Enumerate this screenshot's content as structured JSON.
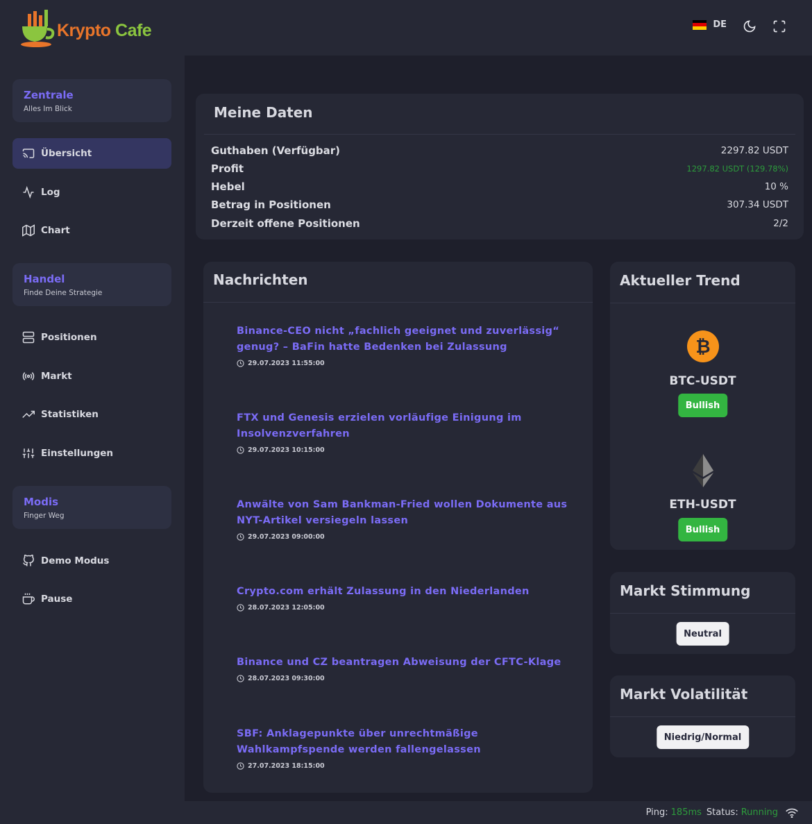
{
  "app": {
    "logo_main": "Krypto",
    "logo_accent": "Cafe"
  },
  "sidebar": {
    "sections": [
      {
        "title": "Zentrale",
        "subtitle": "Alles Im Blick"
      },
      {
        "title": "Handel",
        "subtitle": "Finde Deine Strategie"
      },
      {
        "title": "Modis",
        "subtitle": "Finger Weg"
      }
    ],
    "items": [
      {
        "label": "Übersicht",
        "icon": "screen-cast-icon",
        "active": true
      },
      {
        "label": "Log",
        "icon": "activity-icon"
      },
      {
        "label": "Chart",
        "icon": "map-icon"
      },
      {
        "label": "Positionen",
        "icon": "server-icon"
      },
      {
        "label": "Markt",
        "icon": "broadcast-icon"
      },
      {
        "label": "Statistiken",
        "icon": "trending-up-icon"
      },
      {
        "label": "Einstellungen",
        "icon": "sliders-icon"
      },
      {
        "label": "Demo Modus",
        "icon": "github-icon"
      },
      {
        "label": "Pause",
        "icon": "coffee-icon"
      }
    ]
  },
  "header": {
    "language": "DE",
    "flag_colors": [
      "#000000",
      "#dd0000",
      "#ffce00"
    ]
  },
  "meine_daten": {
    "title": "Meine Daten",
    "rows": [
      {
        "label": "Guthaben (Verfügbar)",
        "value": "2297.82 USDT"
      },
      {
        "label": "Profit",
        "value": "1297.82 USDT (129.78%)"
      },
      {
        "label": "Hebel",
        "value": "10 %"
      },
      {
        "label": "Betrag in Positionen",
        "value": "307.34 USDT"
      },
      {
        "label": "Derzeit offene Positionen",
        "value": "2/2"
      }
    ]
  },
  "news": {
    "title": "Nachrichten",
    "items": [
      {
        "title": "Binance-CEO nicht „fachlich geeignet und zuverlässig“ genug? – BaFin hatte Bedenken bei Zulassung",
        "date": "29.07.2023 11:55:00"
      },
      {
        "title": "FTX und Genesis erzielen vorläufige Einigung im Insolvenzverfahren",
        "date": "29.07.2023 10:15:00"
      },
      {
        "title": "Anwälte von Sam Bankman-Fried wollen Dokumente aus NYT-Artikel versiegeln lassen",
        "date": "29.07.2023 09:00:00"
      },
      {
        "title": "Crypto.com erhält Zulassung in den Niederlanden",
        "date": "28.07.2023 12:05:00"
      },
      {
        "title": "Binance und CZ beantragen Abweisung der CFTC-Klage",
        "date": "28.07.2023 09:30:00"
      },
      {
        "title": "SBF: Anklagepunkte über unrechtmäßige Wahlkampfspende werden fallengelassen",
        "date": "27.07.2023 18:15:00"
      }
    ]
  },
  "trend": {
    "title": "Aktueller Trend",
    "coins": [
      {
        "pair": "BTC-USDT",
        "status": "Bullish",
        "icon": "bitcoin-icon",
        "color": "#f7931a"
      },
      {
        "pair": "ETH-USDT",
        "status": "Bullish",
        "icon": "ethereum-icon",
        "color": "#343434"
      }
    ]
  },
  "stimmung": {
    "title": "Markt Stimmung",
    "value": "Neutral"
  },
  "volatilitaet": {
    "title": "Markt Volatilität",
    "value": "Niedrig/Normal"
  },
  "footer": {
    "ping_label": "Ping:",
    "ping_value": "185ms",
    "status_label": "Status:",
    "status_value": "Running"
  },
  "colors": {
    "accent": "#7b6cf6",
    "bullish": "#33b541",
    "profit": "#2d9c3c"
  }
}
